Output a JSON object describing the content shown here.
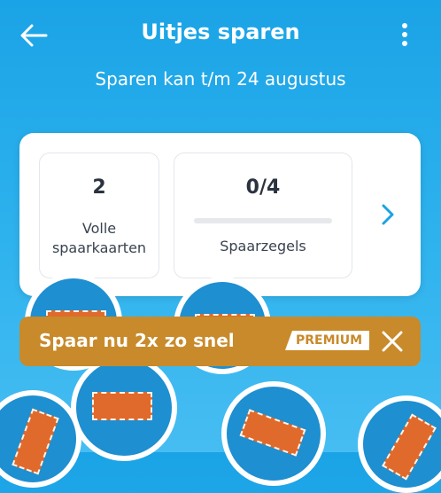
{
  "header": {
    "title": "Uitjes sparen",
    "subtitle": "Sparen kan t/m 24 augustus"
  },
  "stats": {
    "cards_value": "2",
    "cards_label_line1": "Volle",
    "cards_label_line2": "spaarkaarten",
    "stamps_value": "0/4",
    "stamps_label": "Spaarzegels",
    "stamps_progress": 0
  },
  "promo": {
    "text": "Spaar nu 2x zo snel",
    "badge": "PREMIUM"
  },
  "colors": {
    "background": "#1aa3e6",
    "promo": "#c88a2a",
    "card": "#ffffff"
  }
}
